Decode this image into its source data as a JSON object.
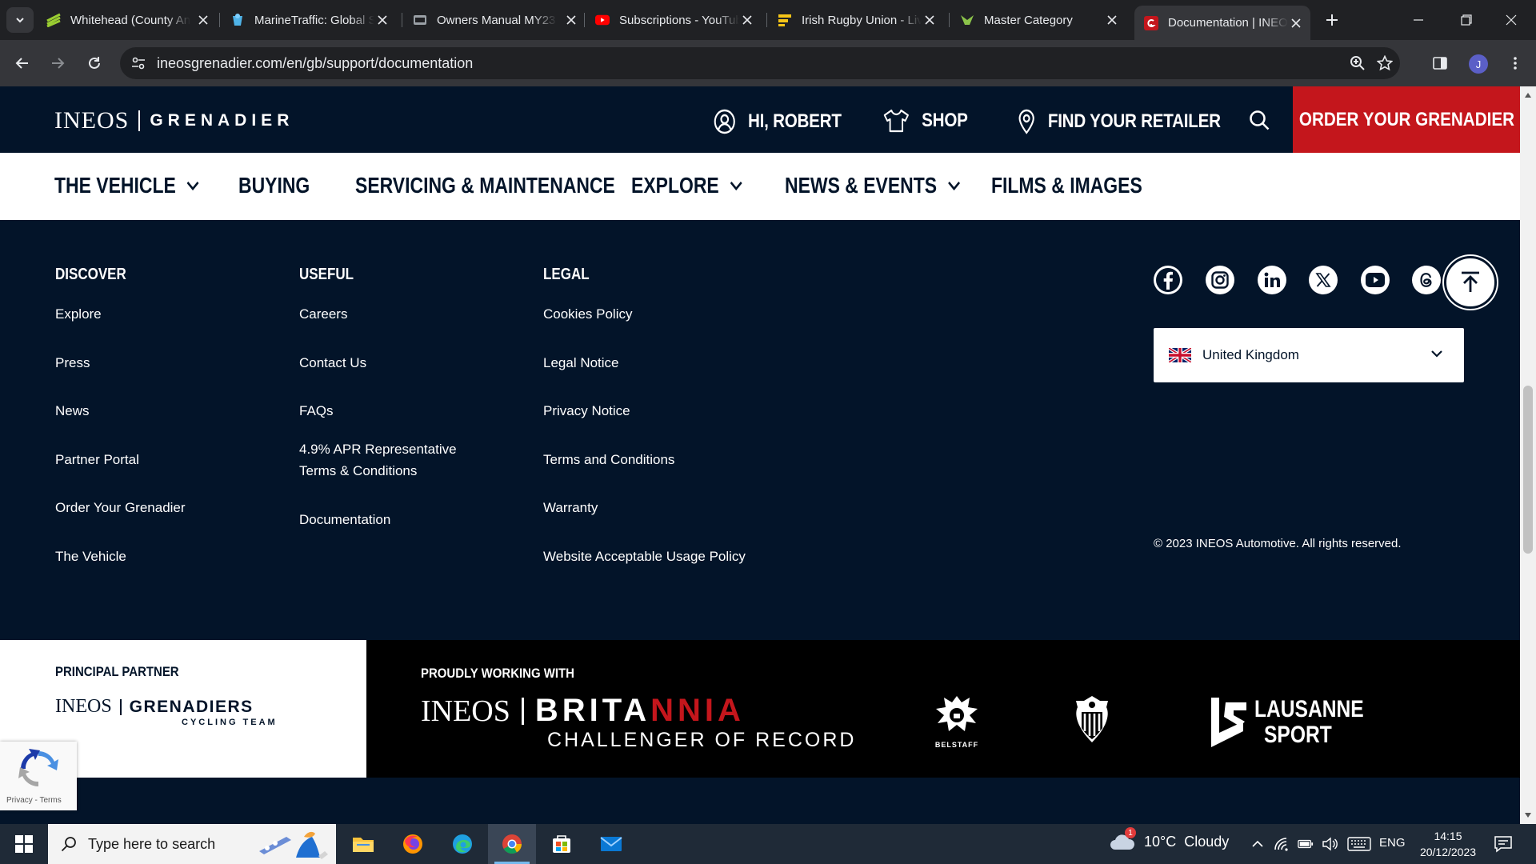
{
  "browser": {
    "tabs": [
      {
        "title": "Whitehead (County Antrim)",
        "icon": "green-stripe-favicon"
      },
      {
        "title": "MarineTraffic: Global Ship Tracking",
        "icon": "marinetraffic-favicon"
      },
      {
        "title": "Owners Manual MY23",
        "icon": "vehicle-favicon"
      },
      {
        "title": "Subscriptions - YouTube",
        "icon": "youtube-favicon"
      },
      {
        "title": "Irish Rugby Union - Live",
        "icon": "rugby-favicon"
      },
      {
        "title": "Master Category",
        "icon": "eagle-favicon"
      },
      {
        "title": "Documentation | INEOS",
        "icon": "grenadier-favicon",
        "active": true
      }
    ],
    "url": "ineosgrenadier.com/en/gb/support/documentation",
    "profile_initial": "J"
  },
  "header": {
    "brand_ineos": "INEOS",
    "brand_grenadier": "GRENADIER",
    "user_link": "HI, ROBERT",
    "shop_link": "SHOP",
    "retailer_link": "FIND YOUR RETAILER",
    "order_button": "ORDER YOUR GRENADIER",
    "accent": "#c4161c",
    "navy": "#031429"
  },
  "nav": {
    "items": [
      {
        "label": "THE VEHICLE",
        "dropdown": true
      },
      {
        "label": "BUYING",
        "dropdown": false
      },
      {
        "label": "SERVICING & MAINTENANCE",
        "dropdown": false
      },
      {
        "label": "EXPLORE",
        "dropdown": true
      },
      {
        "label": "NEWS & EVENTS",
        "dropdown": true
      },
      {
        "label": "FILMS & IMAGES",
        "dropdown": false
      }
    ]
  },
  "footer": {
    "discover": {
      "title": "DISCOVER",
      "links": [
        "Explore",
        "Press",
        "News",
        "Partner Portal",
        "Order Your Grenadier",
        "The Vehicle"
      ]
    },
    "useful": {
      "title": "USEFUL",
      "links": [
        "Careers",
        "Contact Us",
        "FAQs",
        "4.9% APR Representative",
        "Terms & Conditions",
        "Documentation"
      ]
    },
    "legal": {
      "title": "LEGAL",
      "links": [
        "Cookies Policy",
        "Legal Notice",
        "Privacy Notice",
        "Terms and Conditions",
        "Warranty",
        "Website Acceptable Usage Policy"
      ]
    },
    "social": [
      "facebook-icon",
      "instagram-icon",
      "linkedin-icon",
      "x-icon",
      "youtube-icon",
      "threads-icon"
    ],
    "country": "United Kingdom",
    "copyright": "© 2023 INEOS Automotive. All rights reserved."
  },
  "partners": {
    "principal_label": "PRINCIPAL PARTNER",
    "principal_logo": {
      "ineos": "INEOS",
      "name": "GRENADIERS",
      "sub": "CYCLING TEAM"
    },
    "working_label": "PROUDLY WORKING WITH",
    "britannia": {
      "ineos": "INEOS",
      "brit": "BRITA",
      "red": "NNIA",
      "challenger": "CHALLENGER OF RECORD"
    },
    "belstaff": "BELSTAFF",
    "lausanne_line1": "LAUSANNE",
    "lausanne_line2": "SPORT"
  },
  "recaptcha": {
    "links": "Privacy - Terms"
  },
  "taskbar": {
    "search_placeholder": "Type here to search",
    "weather_temp": "10°C",
    "weather_desc": "Cloudy",
    "weather_badge": "1",
    "language": "ENG",
    "time": "14:15",
    "date": "20/12/2023"
  }
}
